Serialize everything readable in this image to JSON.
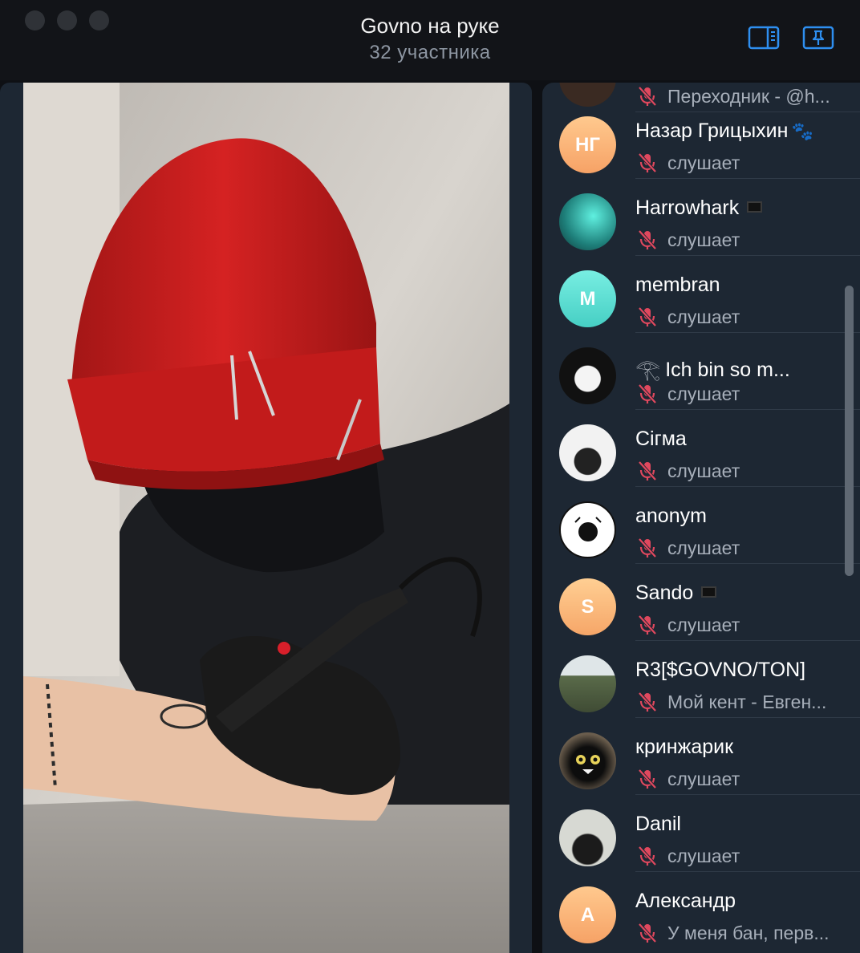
{
  "window": {
    "title": "Govno на руке",
    "subtitle": "32 участника"
  },
  "participants": [
    {
      "name": "",
      "status": "Переходник - @h...",
      "avatar_text": "",
      "avatar_color": "#3a2a22"
    },
    {
      "name": "Назар Грицыхин",
      "status": "слушает",
      "avatar_text": "НГ",
      "avatar_color": "#f7b27a",
      "suffix_icon": "paw-icon"
    },
    {
      "name": "Harrowhark",
      "status": "слушает",
      "avatar_text": "",
      "avatar_color": "#2aa6a0",
      "suffix_icon": "black-square-icon"
    },
    {
      "name": "membran",
      "status": "слушает",
      "avatar_text": "M",
      "avatar_color": "#5ad9cf"
    },
    {
      "name": "Ich bin so m...",
      "status": "слушает",
      "avatar_text": "",
      "avatar_color": "#202020",
      "prefix_icon": "eye-of-horus-icon"
    },
    {
      "name": "Сігма",
      "status": "слушает",
      "avatar_text": "",
      "avatar_color": "#f1f1f1"
    },
    {
      "name": "anonym",
      "status": "слушает",
      "avatar_text": "",
      "avatar_color": "#ffffff"
    },
    {
      "name": "Sando",
      "status": "слушает",
      "avatar_text": "S",
      "avatar_color": "#f9b978",
      "suffix_icon": "black-square-icon"
    },
    {
      "name": "R3[$GOVNO/TON]",
      "status": "Мой кент - Евген...",
      "avatar_text": "",
      "avatar_color": "#6b7a5c"
    },
    {
      "name": "кринжарик",
      "status": "слушает",
      "avatar_text": "",
      "avatar_color": "#1b1b1b"
    },
    {
      "name": "Danil",
      "status": "слушает",
      "avatar_text": "",
      "avatar_color": "#d9dbd6"
    },
    {
      "name": "Александр",
      "status": "У меня бан, перв...",
      "avatar_text": "A",
      "avatar_color": "#f7b27a"
    }
  ]
}
